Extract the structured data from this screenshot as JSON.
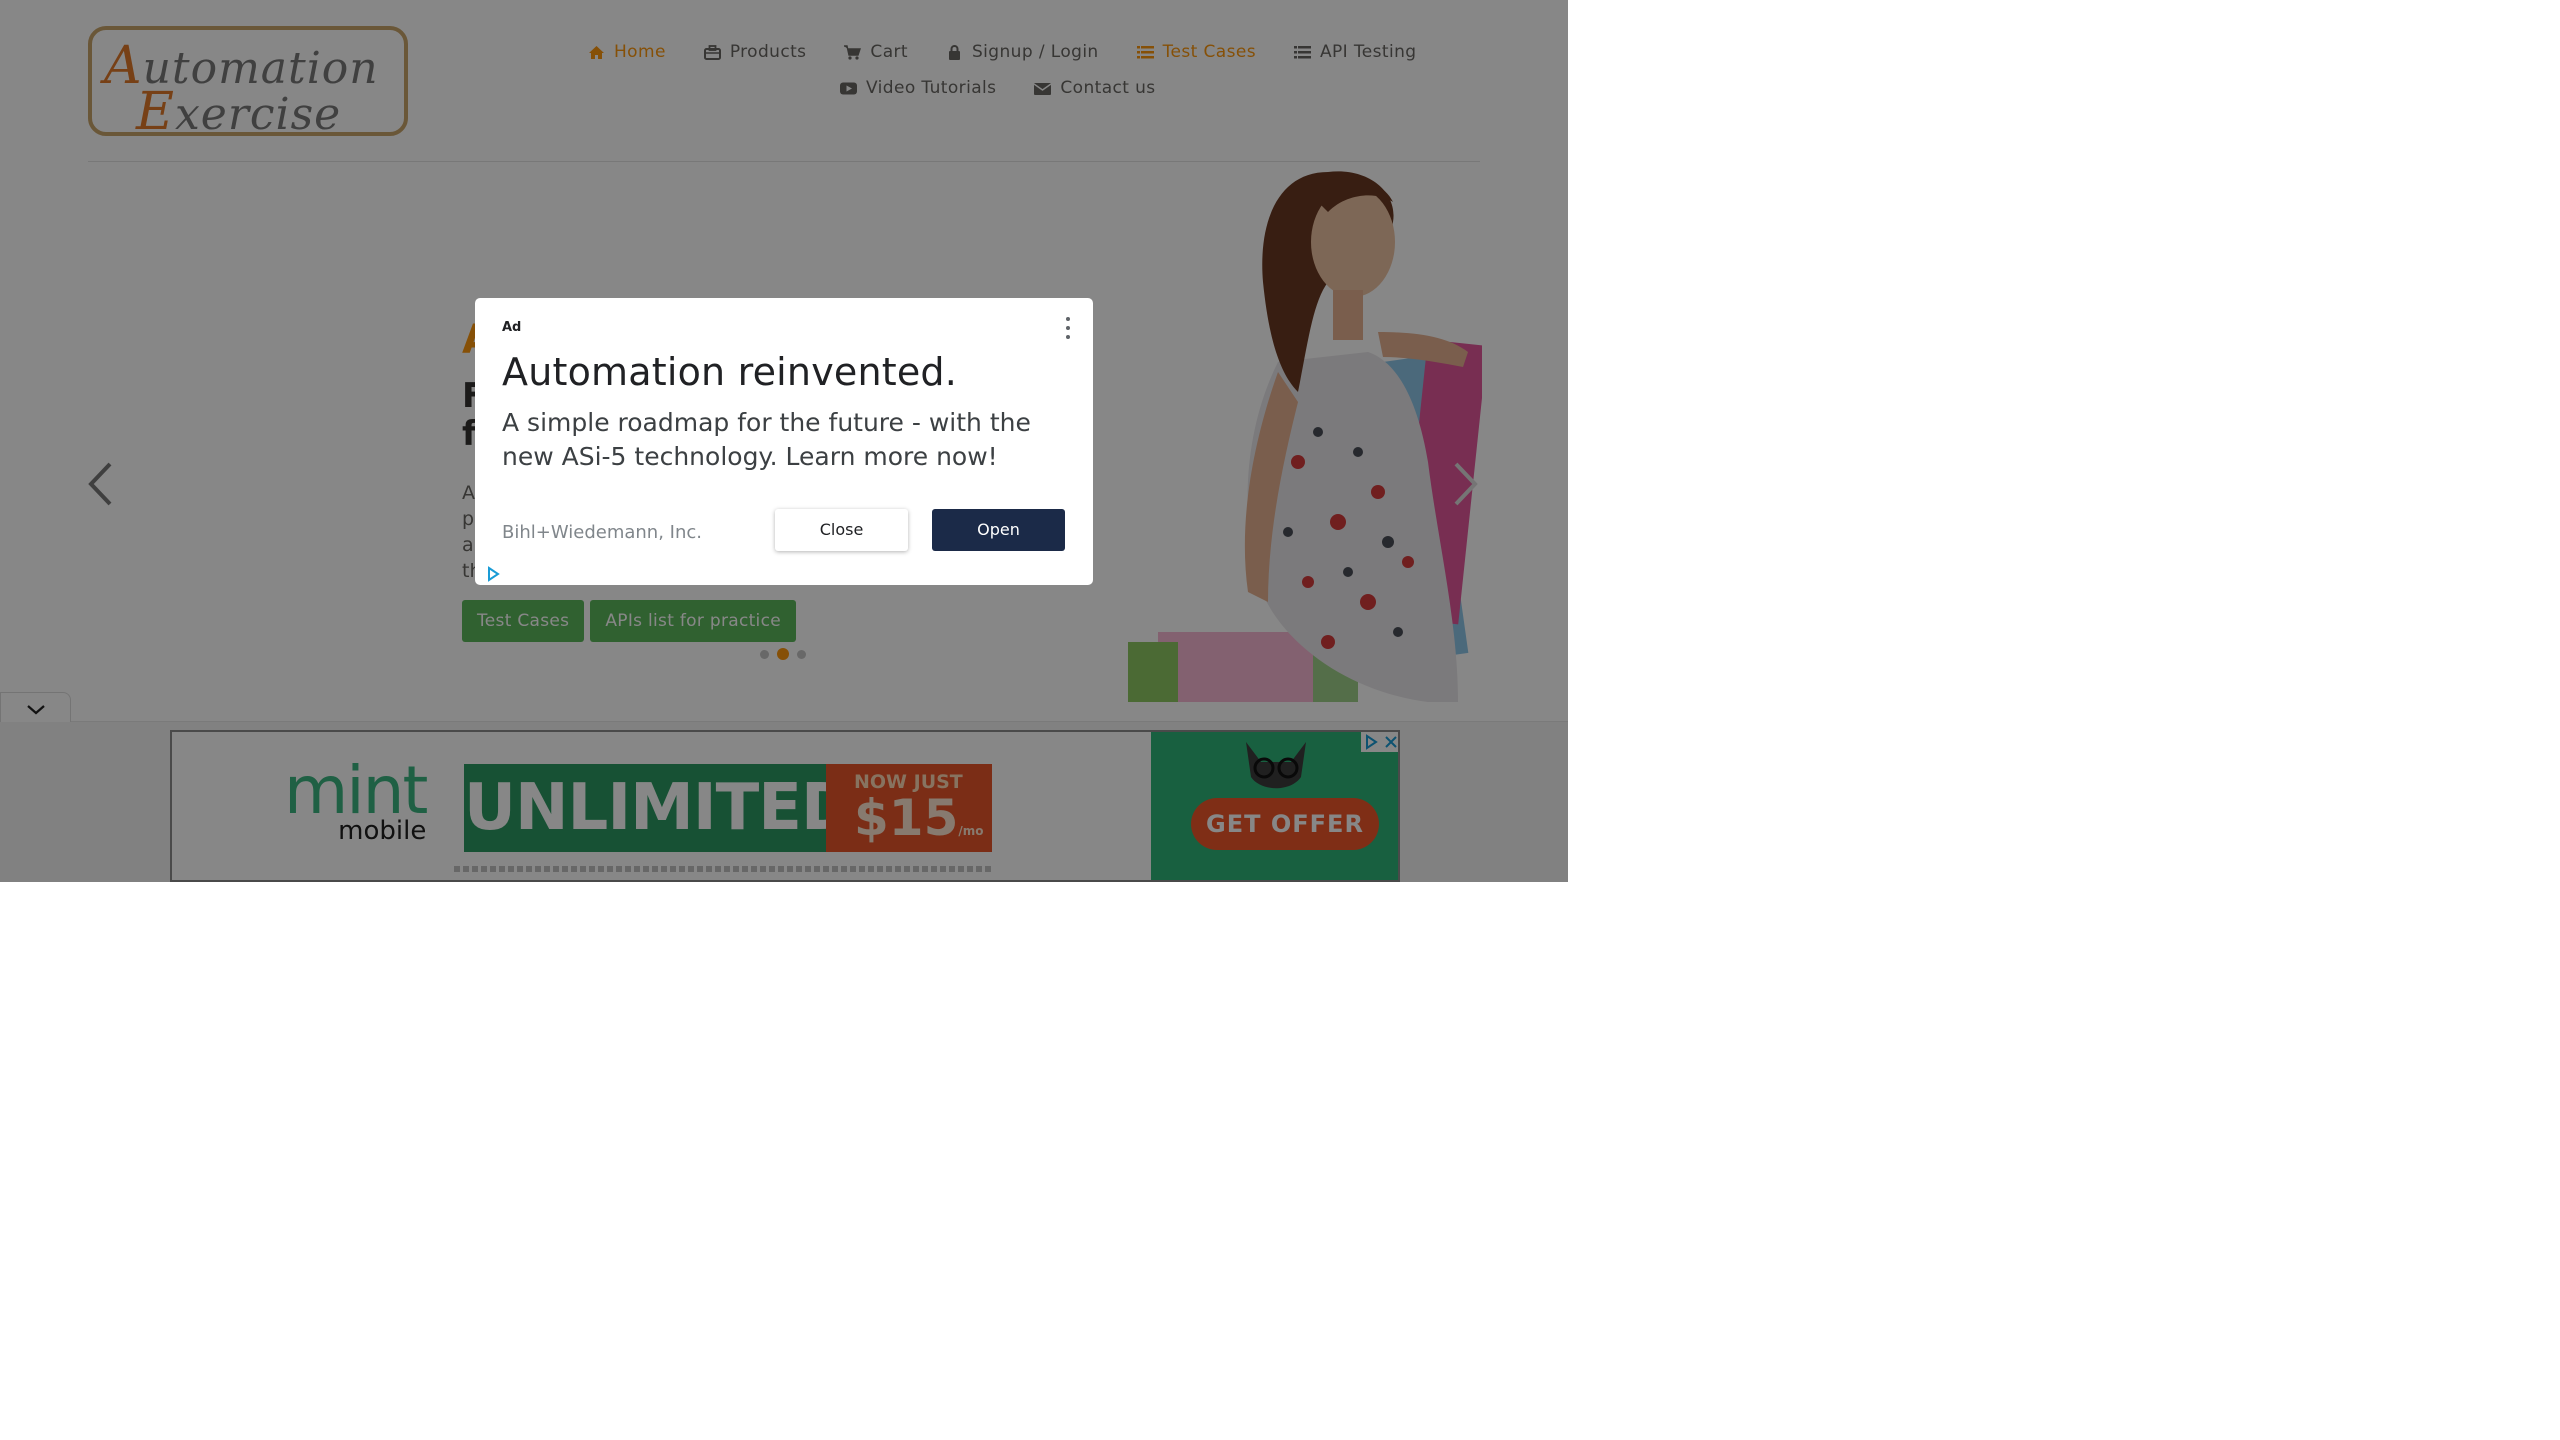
{
  "header": {
    "logo_line1_cap": "A",
    "logo_line1_rest": "utomation",
    "logo_line2_cap": "E",
    "logo_line2_rest": "xercise",
    "nav": [
      {
        "label": "Home",
        "icon": "home-icon",
        "active": true
      },
      {
        "label": "Products",
        "icon": "briefcase-icon",
        "active": false
      },
      {
        "label": "Cart",
        "icon": "cart-icon",
        "active": false
      },
      {
        "label": "Signup / Login",
        "icon": "lock-icon",
        "active": false
      },
      {
        "label": "Test Cases",
        "icon": "list-icon",
        "active": true
      },
      {
        "label": "API Testing",
        "icon": "list-icon",
        "active": false
      },
      {
        "label": "Video Tutorials",
        "icon": "youtube-play-icon",
        "active": false
      },
      {
        "label": "Contact us",
        "icon": "envelope-icon",
        "active": false
      }
    ]
  },
  "slider": {
    "title_fragment": "A",
    "subtitle_fragment": "F\nf",
    "text_fragment": "A\np\na\nth",
    "buttons": [
      "Test Cases",
      "APIs list for practice"
    ],
    "active_dot": 1,
    "dot_count": 3
  },
  "ad_modal": {
    "label": "Ad",
    "headline": "Automation reinvented.",
    "body": "A simple roadmap for the future - with the new ASi-5 technology. Learn more now!",
    "advertiser": "Bihl+Wiedemann, Inc.",
    "close_label": "Close",
    "open_label": "Open"
  },
  "banner_ad": {
    "brand_top": "mint",
    "brand_bottom": "mobile",
    "headline": "UNLIMITED",
    "price_prefix": "NOW JUST",
    "price": "$15",
    "price_suffix": "/mo",
    "cta": "GET OFFER"
  },
  "colors": {
    "accent": "#fe980f",
    "nav_text": "#696763",
    "button_green": "#5cb85c",
    "modal_open_button": "#1b2a48",
    "dimmer": "rgba(0,0,0,0.47)"
  }
}
